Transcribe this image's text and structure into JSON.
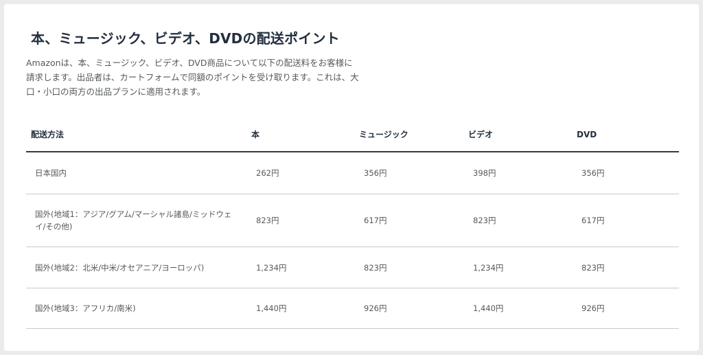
{
  "title": "本、ミュージック、ビデオ、DVDの配送ポイント",
  "description": "Amazonは、本、ミュージック、ビデオ、DVD商品について以下の配送料をお客様に請求します。出品者は、カートフォームで同額のポイントを受け取ります。これは、大口・小口の両方の出品プランに適用されます。",
  "table": {
    "headers": [
      "配送方法",
      "本",
      "ミュージック",
      "ビデオ",
      "DVD"
    ],
    "rows": [
      [
        "日本国内",
        "262円",
        "356円",
        "398円",
        "356円"
      ],
      [
        "国外(地域1：アジア/グアム/マーシャル諸島/ミッドウェイ/その他)",
        "823円",
        "617円",
        "823円",
        "617円"
      ],
      [
        "国外(地域2：北米/中米/オセアニア/ヨーロッパ)",
        "1,234円",
        "823円",
        "1,234円",
        "823円"
      ],
      [
        "国外(地域3：アフリカ/南米)",
        "1,440円",
        "926円",
        "1,440円",
        "926円"
      ]
    ]
  }
}
